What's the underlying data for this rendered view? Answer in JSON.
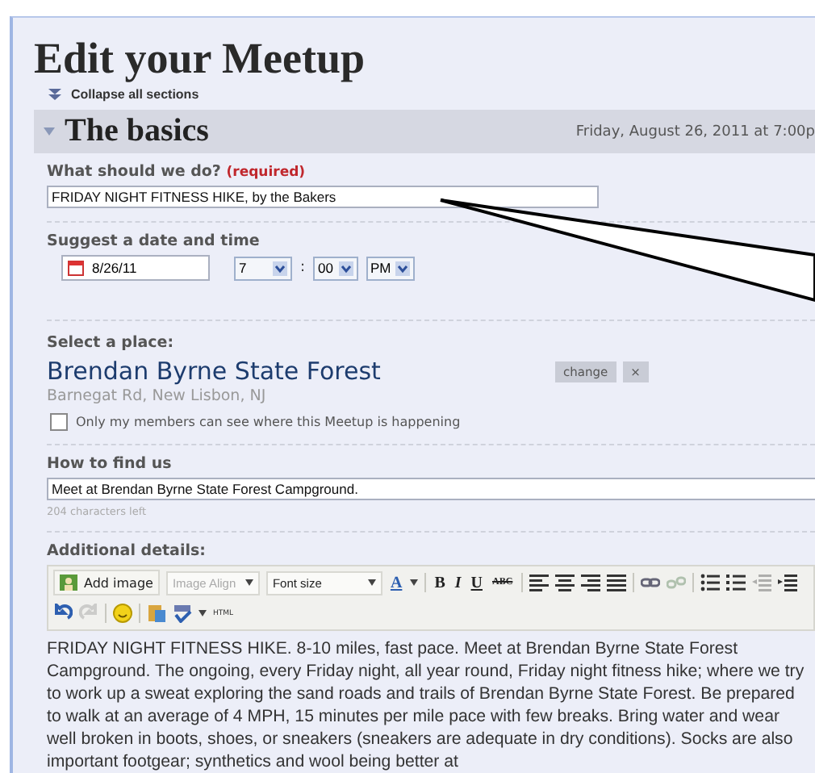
{
  "title": "Edit your Meetup",
  "collapse_link": "Collapse all sections",
  "section": {
    "title": "The basics",
    "expanded": true,
    "date": "Friday, August 26, 2011 at 7:00p"
  },
  "what": {
    "label": "What should we do?",
    "required": "(required)",
    "value": "FRIDAY NIGHT FITNESS HIKE, by the Bakers"
  },
  "datetime": {
    "label": "Suggest a date and time",
    "date": "8/26/11",
    "hour": "7",
    "separator": ":",
    "minute": "00",
    "ampm": "PM"
  },
  "place": {
    "label": "Select a place:",
    "name": "Brendan Byrne State Forest",
    "address": "Barnegat Rd, New Lisbon, NJ",
    "change": "change",
    "remove": "×",
    "private_label": "Only my members can see where this Meetup is happening",
    "private_checked": false
  },
  "find": {
    "label": "How to find us",
    "value": "Meet at Brendan Byrne State Forest Campground.",
    "counter": "204 characters left"
  },
  "details": {
    "label": "Additional details:",
    "toolbar": {
      "add_image": "Add image",
      "image_align": {
        "label": "Image Align",
        "disabled": true
      },
      "font_size": "Font size",
      "text_color": "A",
      "bold": "B",
      "italic": "I",
      "underline": "U",
      "strike": "ABC",
      "unlink_disabled": true,
      "outdent_disabled": true,
      "redo_disabled": true,
      "html": "HTML"
    },
    "text": "FRIDAY NIGHT FITNESS HIKE. 8-10 miles, fast pace. Meet at Brendan Byrne State Forest Campground. The ongoing, every Friday night, all year round, Friday night fitness hike; where we try to work up a sweat exploring the sand roads and trails of Brendan Byrne State Forest. Be prepared to walk at an average of 4 MPH, 15 minutes per mile pace with few breaks. Bring water and wear well broken in boots, shoes, or sneakers (sneakers are adequate in dry conditions). Socks are also important footgear; synthetics and wool being better at"
  }
}
